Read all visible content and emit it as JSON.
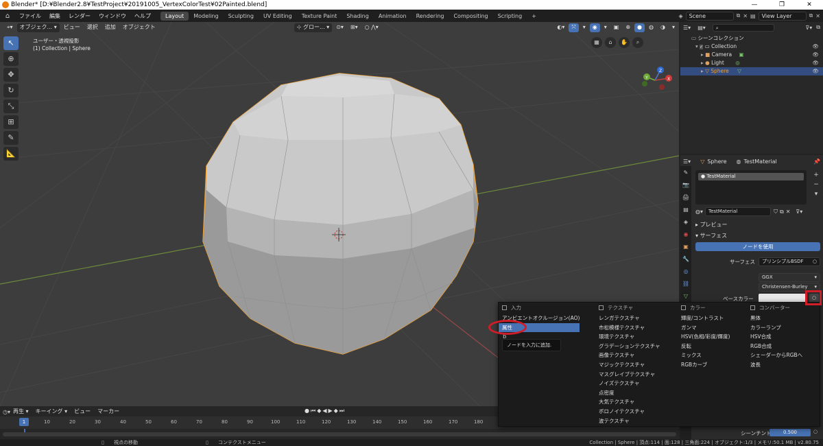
{
  "window": {
    "title": "Blender* [D:¥Blender2.8¥TestProject¥20191005_VertexColorTest¥02Painted.blend]",
    "controls": [
      "—",
      "❐",
      "✕"
    ]
  },
  "menubar": {
    "items": [
      "ファイル",
      "編集",
      "レンダー",
      "ウィンドウ",
      "ヘルプ"
    ],
    "workspaces": [
      "Layout",
      "Modeling",
      "Sculpting",
      "UV Editing",
      "Texture Paint",
      "Shading",
      "Animation",
      "Rendering",
      "Compositing",
      "Scripting"
    ],
    "active_workspace": "Layout",
    "add_tab": "+",
    "scene": "Scene",
    "view_layer": "View Layer"
  },
  "viewport": {
    "header_items": [
      "オブジェク...",
      "ビュー",
      "選択",
      "追加",
      "オブジェクト"
    ],
    "transform_orientation": "グロー...",
    "overlay_line1": "ユーザー・透視投影",
    "overlay_line2": "(1) Collection | Sphere",
    "gizmo_x": "X",
    "gizmo_y": "Y",
    "gizmo_z": "Z"
  },
  "outliner": {
    "rows": [
      {
        "label": "シーンコレクション",
        "indent": 0
      },
      {
        "label": "Collection",
        "indent": 1
      },
      {
        "label": "Camera",
        "indent": 2
      },
      {
        "label": "Light",
        "indent": 2
      },
      {
        "label": "Sphere",
        "indent": 2,
        "selected": true
      }
    ]
  },
  "properties": {
    "breadcrumb_object": "Sphere",
    "breadcrumb_material": "TestMaterial",
    "slot_name": "TestMaterial",
    "material_field": "TestMaterial",
    "panel_preview": "プレビュー",
    "panel_surface": "サーフェス",
    "use_nodes_button": "ノードを使用",
    "surface_label": "サーフェス",
    "surface_value": "プリンシプルBSDF",
    "distribution": "GGX",
    "subsurface_method": "Christensen-Burley",
    "base_color_label": "ベースカラー",
    "sheen_tint_label": "シーンチント",
    "sheen_tint_value": "0.500"
  },
  "add_menu": {
    "columns": [
      {
        "header": "入力",
        "items": [
          "アンビエントオクルージョン(AO)",
          "属性",
          "ｂ"
        ]
      },
      {
        "header": "テクスチャ",
        "items": [
          "レンガテクスチャ",
          "市松模様テクスチャ",
          "環境テクスチャ",
          "グラデーションテクスチャ",
          "画像テクスチャ",
          "マジックテクスチャ",
          "マスグレイブテクスチャ",
          "ノイズテクスチャ",
          "点密度",
          "大気テクスチャ",
          "ボロノイテクスチャ",
          "波テクスチャ"
        ]
      },
      {
        "header": "カラー",
        "items": [
          "輝度/コントラスト",
          "ガンマ",
          "HSV(色相/彩度/輝度)",
          "反転",
          "ミックス",
          "RGBカーブ"
        ]
      },
      {
        "header": "コンバーター",
        "items": [
          "黒体",
          "カラーランプ",
          "HSV合成",
          "RGB合成",
          "シェーダーからRGBへ",
          "波長"
        ]
      }
    ],
    "highlighted": "属性",
    "tooltip": "ノードを入力に追加."
  },
  "timeline": {
    "menu": [
      "再生",
      "キーイング",
      "ビュー",
      "マーカー"
    ],
    "current_frame": "1",
    "ticks": [
      "10",
      "20",
      "30",
      "40",
      "50",
      "60",
      "70",
      "80",
      "90",
      "100",
      "110",
      "120",
      "130",
      "140",
      "150",
      "160",
      "170",
      "180"
    ]
  },
  "statusbar": {
    "left1": "視点の移動",
    "left2": "コンテクストメニュー",
    "right": "Collection | Sphere | 頂点:114 | 面:128 | 三角面:224 | オブジェクト:1/3 | メモリ:50.1 MB | v2.80.75"
  },
  "colors": {
    "accent": "#4772b3",
    "selection_outline": "#f0a030",
    "annotation_red": "#d01d28",
    "viewport_bg": "#3d3d3d"
  }
}
